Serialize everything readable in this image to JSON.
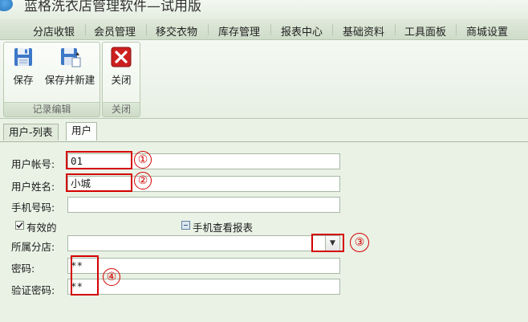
{
  "window": {
    "title": "蓝格洗衣店管理软件—试用版"
  },
  "menu": [
    "分店收银",
    "会员管理",
    "移交衣物",
    "库存管理",
    "报表中心",
    "基础资料",
    "工具面板",
    "商城设置"
  ],
  "ribbon": {
    "groups": [
      {
        "label": "记录编辑",
        "buttons": [
          "保存",
          "保存并新建"
        ]
      },
      {
        "label": "关闭",
        "buttons": [
          "关闭"
        ]
      }
    ]
  },
  "tabs": [
    "用户-列表",
    "用户"
  ],
  "form": {
    "account_label": "用户帐号:",
    "account_value": "01",
    "name_label": "用户姓名:",
    "name_value": "小城",
    "phone_label": "手机号码:",
    "phone_value": "",
    "valid_label": "有效的",
    "mobile_report_label": "手机查看报表",
    "branch_label": "所属分店:",
    "branch_value": "",
    "password_label": "密码:",
    "password_value": "**",
    "confirm_label": "验证密码:",
    "confirm_value": "**"
  },
  "annotations": [
    "①",
    "②",
    "③",
    "④"
  ],
  "colors": {
    "highlight": "#d40000",
    "background": "#eaf2e6"
  }
}
